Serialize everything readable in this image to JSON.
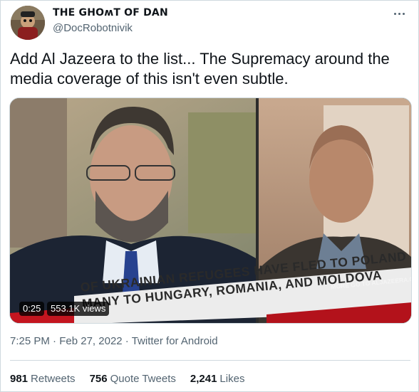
{
  "author": {
    "display_name": "THE GHOʍT OF DAN",
    "handle": "@DocRobotnivik"
  },
  "tweet": {
    "text": "Add Al Jazeera to the list... The Supremacy around the media coverage of this isn't even subtle."
  },
  "media": {
    "chyron_line1": "OF UKRAINIAN REFUGEES HAVE FLED TO POLAND",
    "chyron_line2": "MANY TO HUNGARY, ROMANIA, AND MOLDOVA",
    "chyron_url": "MORE GO TO ALJAZEERA.COM/WEATHER",
    "duration": "0:25",
    "views": "553.1K views"
  },
  "meta": {
    "time": "7:25 PM",
    "separator": "·",
    "date": "Feb 27, 2022",
    "source": "Twitter for Android"
  },
  "stats": {
    "retweets_count": "981",
    "retweets_label": "Retweets",
    "quotes_count": "756",
    "quotes_label": "Quote Tweets",
    "likes_count": "2,241",
    "likes_label": "Likes"
  },
  "colors": {
    "text_primary": "#0f1419",
    "text_secondary": "#536471",
    "border": "#cfd9de"
  },
  "icons": {
    "more": "more-horizontal-icon"
  }
}
